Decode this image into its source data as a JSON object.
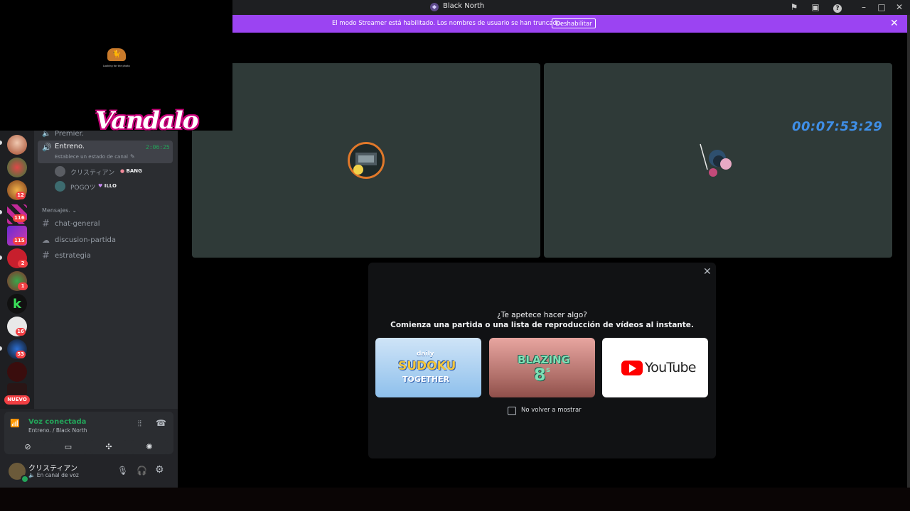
{
  "window": {
    "title": "Black North",
    "title_icon": "server-emblem-icon",
    "controls": [
      "inbox-flag-icon",
      "screen-share-icon",
      "help-icon",
      "minimize-icon",
      "maximize-icon",
      "close-icon"
    ]
  },
  "banner": {
    "text": "El modo Streamer está habilitado. Los nombres de usuario se han truncado.",
    "button_label": "Deshabilitar",
    "color": "#9b44f2"
  },
  "overlay": {
    "caption": "Looking for the photo",
    "logo_text": "Vandalo"
  },
  "server_rail": {
    "badges": [
      "12",
      "116",
      "115",
      "2",
      "1",
      "16",
      "53"
    ],
    "new_label": "NUEVO"
  },
  "channels": {
    "voice_channel_above": "Premier.",
    "active_voice": {
      "name": "Entreno.",
      "timer": "2:06:25",
      "status_placeholder": "Establece un estado de canal"
    },
    "members": [
      {
        "name": "クリスティアン",
        "tag": "BANG"
      },
      {
        "name": "POGOツ",
        "tag": "ILLO"
      }
    ],
    "category": "Mensajes.",
    "text_channels": [
      {
        "name": "chat-general",
        "icon": "hash-icon"
      },
      {
        "name": "discusion-partida",
        "icon": "thread-hash-icon"
      },
      {
        "name": "estrategia",
        "icon": "hash-icon"
      }
    ]
  },
  "voice_panel": {
    "status": "Voz conectada",
    "location": "Entreno. / Black North",
    "status_color": "#23a55a"
  },
  "user_panel": {
    "username": "クリスティアン",
    "status": "En canal de voz"
  },
  "stage": {
    "timer_overlay": "00:07:53:29"
  },
  "activity_modal": {
    "heading": "¿Te apetece hacer algo?",
    "subheading": "Comienza una partida o una lista de reproducción de vídeos al instante.",
    "cards": [
      {
        "title": "daily",
        "subtitle": "SUDOKU",
        "extra": "TOGETHER"
      },
      {
        "title": "BLAZING",
        "subtitle": "8",
        "extra": "s"
      },
      {
        "title": "YouTube"
      }
    ],
    "checkbox_label": "No volver a mostrar"
  }
}
